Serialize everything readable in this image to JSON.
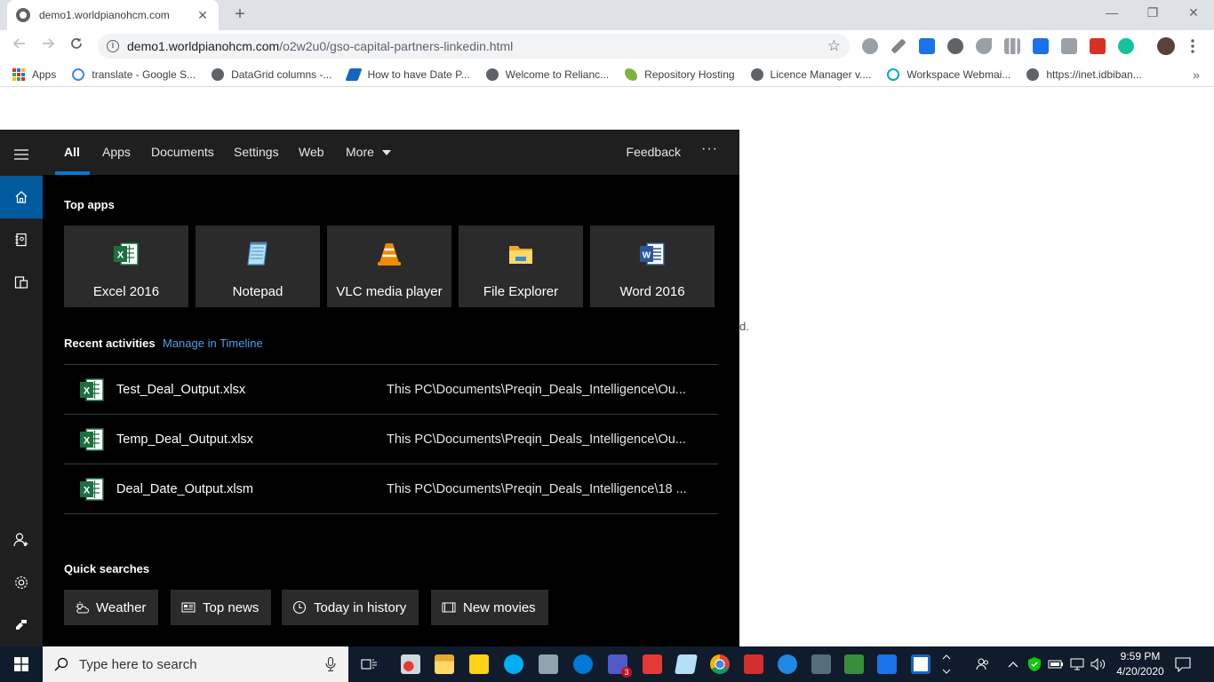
{
  "browser": {
    "tab_title": "demo1.worldpianohcm.com",
    "tab_close": "✕",
    "new_tab": "+",
    "url_host": "demo1.worldpianohcm.com",
    "url_path": "/o2w2u0/gso-capital-partners-linkedin.html",
    "minimize": "—",
    "restore": "❐",
    "close": "✕"
  },
  "bookmarks": [
    {
      "label": "Apps"
    },
    {
      "label": "translate - Google S..."
    },
    {
      "label": "DataGrid columns -..."
    },
    {
      "label": "How to have Date P..."
    },
    {
      "label": "Welcome to Relianc..."
    },
    {
      "label": "Repository Hosting"
    },
    {
      "label": "Licence Manager v...."
    },
    {
      "label": "Workspace Webmai..."
    },
    {
      "label": "https://inet.idbiban..."
    }
  ],
  "bookmarks_more": "»",
  "page_fragment": "d.",
  "search_panel": {
    "tabs": [
      {
        "label": "All"
      },
      {
        "label": "Apps"
      },
      {
        "label": "Documents"
      },
      {
        "label": "Settings"
      },
      {
        "label": "Web"
      },
      {
        "label": "More"
      }
    ],
    "feedback": "Feedback",
    "more_options": "···",
    "top_apps_title": "Top apps",
    "top_apps": [
      {
        "label": "Excel 2016",
        "icon": "excel-icon"
      },
      {
        "label": "Notepad",
        "icon": "notepad-icon"
      },
      {
        "label": "VLC media player",
        "icon": "vlc-icon"
      },
      {
        "label": "File Explorer",
        "icon": "folder-icon"
      },
      {
        "label": "Word 2016",
        "icon": "word-icon"
      }
    ],
    "recent_title": "Recent activities",
    "manage_timeline": "Manage in Timeline",
    "recent": [
      {
        "name": "Test_Deal_Output.xlsx",
        "path": "This PC\\Documents\\Preqin_Deals_Intelligence\\Ou..."
      },
      {
        "name": "Temp_Deal_Output.xlsx",
        "path": "This PC\\Documents\\Preqin_Deals_Intelligence\\Ou..."
      },
      {
        "name": "Deal_Date_Output.xlsm",
        "path": "This PC\\Documents\\Preqin_Deals_Intelligence\\18 ..."
      }
    ],
    "quick_title": "Quick searches",
    "quick": [
      {
        "label": "Weather",
        "icon": "weather-icon"
      },
      {
        "label": "Top news",
        "icon": "news-icon"
      },
      {
        "label": "Today in history",
        "icon": "clock-icon"
      },
      {
        "label": "New movies",
        "icon": "movie-icon"
      }
    ]
  },
  "taskbar": {
    "search_placeholder": "Type here to search",
    "teams_badge": "3",
    "time": "9:59 PM",
    "date": "4/20/2020"
  },
  "colors": {
    "accent": "#0078d7",
    "panel_bg": "#000000",
    "tile_bg": "#2b2b2b",
    "link": "#4aa0ec",
    "taskbar": "#101b2b"
  }
}
